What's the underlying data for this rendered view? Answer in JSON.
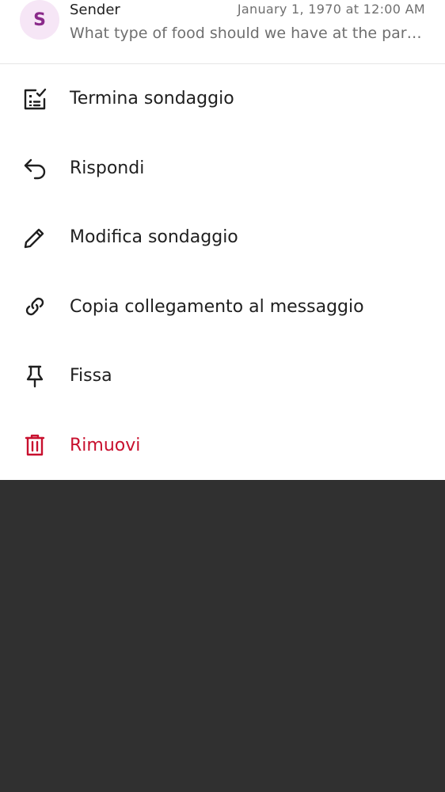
{
  "header": {
    "avatar_initial": "S",
    "sender": "Sender",
    "timestamp": "January 1, 1970 at 12:00 AM",
    "preview": "What type of food should we have at the party?"
  },
  "menu": {
    "items": [
      {
        "label": "Termina sondaggio",
        "icon": "poll-check-icon"
      },
      {
        "label": "Rispondi",
        "icon": "reply-icon"
      },
      {
        "label": "Modifica sondaggio",
        "icon": "pencil-icon"
      },
      {
        "label": "Copia collegamento al messaggio",
        "icon": "link-icon"
      },
      {
        "label": "Fissa",
        "icon": "pin-icon"
      },
      {
        "label": "Rimuovi",
        "icon": "trash-icon"
      }
    ]
  },
  "colors": {
    "danger": "#c8102e",
    "text": "#1f1f1f",
    "muted": "#6f6f6f",
    "avatar_bg": "#f6e6f6",
    "avatar_fg": "#8a2a8a",
    "scrim": "#303030"
  }
}
